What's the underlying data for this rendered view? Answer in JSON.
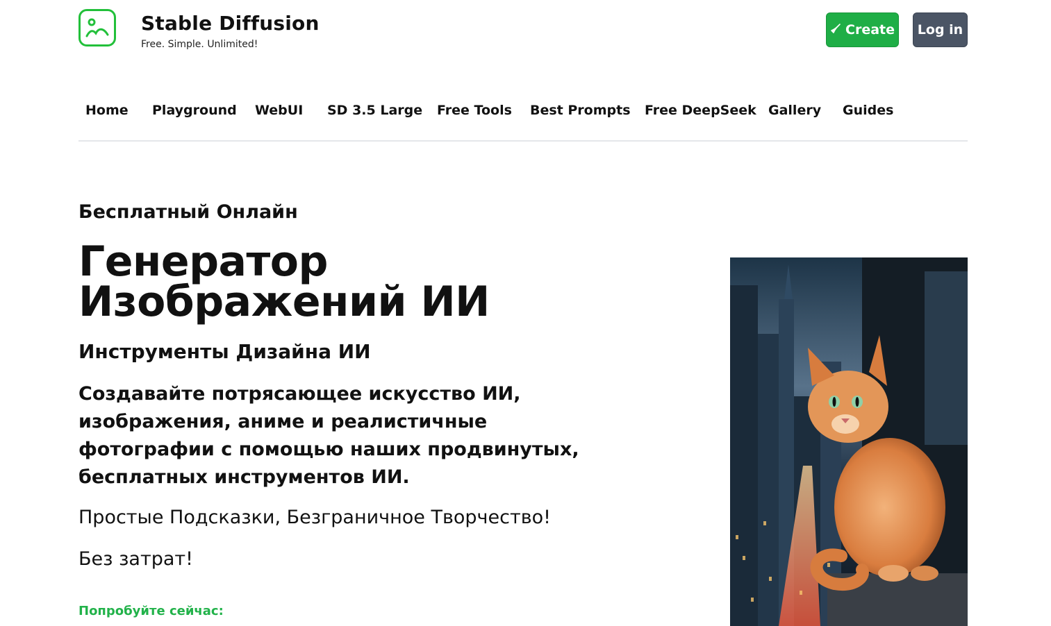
{
  "header": {
    "brand_name": "Stable Diffusion",
    "tagline": "Free. Simple. Unlimited!",
    "create_label": "Create",
    "login_label": "Log in",
    "accent_color": "#22c03a",
    "create_color": "#1fae46",
    "login_color": "#4b5565",
    "icons": [
      "image-logo-icon",
      "rocket-icon"
    ]
  },
  "nav": {
    "items": [
      {
        "label": "Home"
      },
      {
        "label": "Playground"
      },
      {
        "label": "WebUI"
      },
      {
        "label": "SD 3.5 Large"
      },
      {
        "label": "Free Tools"
      },
      {
        "label": "Best Prompts"
      },
      {
        "label": "Free DeepSeek"
      },
      {
        "label": "Gallery"
      },
      {
        "label": "Guides"
      }
    ]
  },
  "hero": {
    "kicker": "Бесплатный Онлайн",
    "title": "Генератор Изображений ИИ",
    "subtitle": "Инструменты Дизайна ИИ",
    "lead": "Создавайте потрясающее искусство ИИ, изображения, аниме и реалистичные фотографии с помощью наших продвинутых, бесплатных инструментов ИИ.",
    "line1": "Простые Подсказки, Безграничное Творчество!",
    "line2": "Без затрат!",
    "try_label": "Попробуйте сейчас:",
    "try_color": "#22b24a"
  }
}
